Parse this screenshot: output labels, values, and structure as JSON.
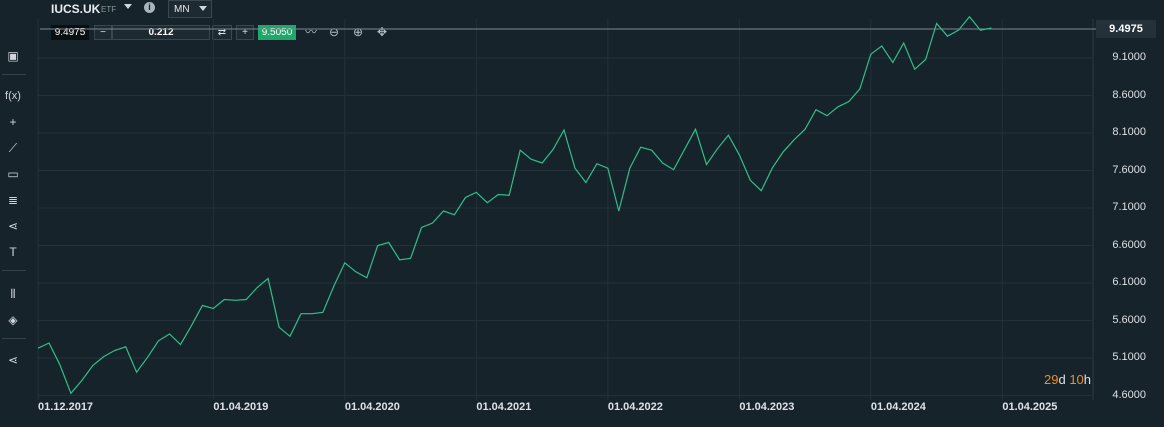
{
  "header": {
    "symbol": "IUCS.UK",
    "type_badge": "ETF",
    "info_icon": "info-icon",
    "timeframe": "MN"
  },
  "order_panel": {
    "sell_price": "9.4975",
    "quantity": "0.212",
    "buy_price": "9.5050",
    "minus_label": "−",
    "plus_label": "+",
    "swap_icon": "swap-arrows-icon",
    "icons": [
      "line-chart-icon",
      "zoom-out-icon",
      "zoom-in-icon",
      "move-cross-icon"
    ]
  },
  "sidebar": {
    "icons": [
      "screen-icon",
      "function-icon",
      "crosshair-icon",
      "trend-line-icon",
      "rectangle-icon",
      "fibonacci-icon",
      "pitchfork-icon",
      "text-icon",
      "indicators-icon",
      "layers-icon",
      "share-icon"
    ],
    "fx_label": "f(x)",
    "text_tool": "T"
  },
  "countdown": {
    "days": "29",
    "d": "d",
    "hours": "10",
    "h": "h"
  },
  "colors": {
    "line": "#2fbf8a",
    "buy_box": "#1fa86b",
    "background": "#17232b",
    "grid": "#22303a"
  },
  "chart_data": {
    "type": "line",
    "title": "",
    "xlabel": "",
    "ylabel": "",
    "current_value": "9.4975",
    "ylim": [
      4.6,
      9.6
    ],
    "yticks": [
      "9.1000",
      "8.6000",
      "8.1000",
      "7.6000",
      "7.1000",
      "6.6000",
      "6.1000",
      "5.6000",
      "5.1000",
      "4.6000"
    ],
    "ytick_values": [
      9.1,
      8.6,
      8.1,
      7.6,
      7.1,
      6.6,
      6.1,
      5.6,
      5.1,
      4.6
    ],
    "xticks": [
      "01.12.2017",
      "01.04.2019",
      "01.04.2020",
      "01.04.2021",
      "01.04.2022",
      "01.04.2023",
      "01.04.2024",
      "01.04.2025"
    ],
    "xtick_month_index": [
      0,
      16,
      28,
      40,
      52,
      64,
      76,
      88
    ],
    "start": "2017-12",
    "series": [
      {
        "values": [
          5.23,
          5.3,
          5.01,
          4.63,
          4.8,
          5.0,
          5.12,
          5.2,
          5.25,
          4.91,
          5.11,
          5.33,
          5.42,
          5.28,
          5.53,
          5.8,
          5.76,
          5.88,
          5.87,
          5.88,
          6.04,
          6.16,
          5.51,
          5.39,
          5.69,
          5.69,
          5.71,
          6.06,
          6.37,
          6.25,
          6.17,
          6.6,
          6.64,
          6.41,
          6.43,
          6.84,
          6.9,
          7.06,
          7.01,
          7.24,
          7.31,
          7.17,
          7.28,
          7.27,
          7.87,
          7.75,
          7.7,
          7.88,
          8.14,
          7.63,
          7.44,
          7.69,
          7.63,
          7.06,
          7.63,
          7.91,
          7.87,
          7.7,
          7.61,
          7.88,
          8.15,
          7.68,
          7.89,
          8.07,
          7.81,
          7.47,
          7.33,
          7.63,
          7.85,
          8.01,
          8.15,
          8.41,
          8.33,
          8.45,
          8.52,
          8.69,
          9.15,
          9.26,
          9.04,
          9.3,
          8.95,
          9.08,
          9.56,
          9.39,
          9.47,
          9.65,
          9.47,
          9.5
        ]
      }
    ]
  }
}
